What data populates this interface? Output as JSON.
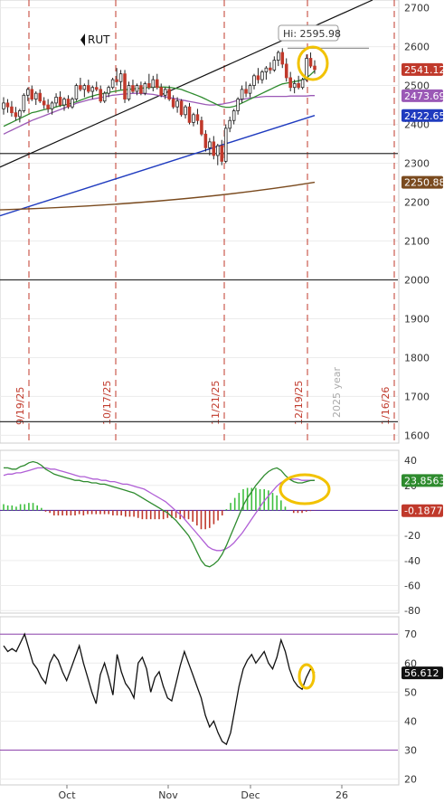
{
  "chart_data": [
    {
      "type": "candlestick",
      "ticker": "RUT",
      "y_ticks": [
        1600,
        1700,
        1800,
        1900,
        2000,
        2100,
        2200,
        2300,
        2400,
        2500,
        2600,
        2700
      ],
      "ylim": [
        1580,
        2720
      ],
      "x_labels": [
        "Oct",
        "Nov",
        "Dec",
        "26"
      ],
      "hi_label": "Hi: 2595.98",
      "hi_value": 2595.98,
      "badges": [
        {
          "text": "2541.12",
          "value": 2541.12,
          "color": "#c0392b"
        },
        {
          "text": "2473.69",
          "value": 2473.69,
          "color": "#9b59b6"
        },
        {
          "text": "2422.65",
          "value": 2422.65,
          "color": "#1f3bbf"
        },
        {
          "text": "2250.88",
          "value": 2250.88,
          "color": "#7a4a1e"
        }
      ],
      "horizontal_lines": [
        2325,
        2000,
        1635
      ],
      "vertical_date_labels": [
        "9/19/25",
        "10/17/25",
        "11/21/25",
        "12/19/25",
        "1/16/26"
      ],
      "year_label": "2025 year",
      "candles": [
        {
          "o": 2440,
          "h": 2470,
          "l": 2425,
          "c": 2455
        },
        {
          "o": 2455,
          "h": 2465,
          "l": 2430,
          "c": 2445
        },
        {
          "o": 2445,
          "h": 2460,
          "l": 2420,
          "c": 2430
        },
        {
          "o": 2430,
          "h": 2445,
          "l": 2410,
          "c": 2420
        },
        {
          "o": 2420,
          "h": 2440,
          "l": 2405,
          "c": 2435
        },
        {
          "o": 2435,
          "h": 2480,
          "l": 2430,
          "c": 2475
        },
        {
          "o": 2475,
          "h": 2495,
          "l": 2460,
          "c": 2490
        },
        {
          "o": 2490,
          "h": 2500,
          "l": 2460,
          "c": 2465
        },
        {
          "o": 2465,
          "h": 2485,
          "l": 2450,
          "c": 2480
        },
        {
          "o": 2480,
          "h": 2490,
          "l": 2455,
          "c": 2460
        },
        {
          "o": 2460,
          "h": 2470,
          "l": 2440,
          "c": 2450
        },
        {
          "o": 2450,
          "h": 2465,
          "l": 2430,
          "c": 2440
        },
        {
          "o": 2440,
          "h": 2460,
          "l": 2425,
          "c": 2455
        },
        {
          "o": 2455,
          "h": 2480,
          "l": 2445,
          "c": 2470
        },
        {
          "o": 2470,
          "h": 2485,
          "l": 2445,
          "c": 2450
        },
        {
          "o": 2450,
          "h": 2470,
          "l": 2435,
          "c": 2465
        },
        {
          "o": 2465,
          "h": 2475,
          "l": 2440,
          "c": 2445
        },
        {
          "o": 2445,
          "h": 2470,
          "l": 2440,
          "c": 2465
        },
        {
          "o": 2465,
          "h": 2505,
          "l": 2460,
          "c": 2500
        },
        {
          "o": 2500,
          "h": 2520,
          "l": 2485,
          "c": 2490
        },
        {
          "o": 2490,
          "h": 2505,
          "l": 2470,
          "c": 2500
        },
        {
          "o": 2500,
          "h": 2515,
          "l": 2480,
          "c": 2485
        },
        {
          "o": 2485,
          "h": 2500,
          "l": 2465,
          "c": 2495
        },
        {
          "o": 2495,
          "h": 2510,
          "l": 2485,
          "c": 2490
        },
        {
          "o": 2490,
          "h": 2500,
          "l": 2455,
          "c": 2460
        },
        {
          "o": 2460,
          "h": 2485,
          "l": 2455,
          "c": 2480
        },
        {
          "o": 2480,
          "h": 2500,
          "l": 2470,
          "c": 2495
        },
        {
          "o": 2495,
          "h": 2520,
          "l": 2490,
          "c": 2515
        },
        {
          "o": 2515,
          "h": 2545,
          "l": 2500,
          "c": 2510
        },
        {
          "o": 2510,
          "h": 2540,
          "l": 2490,
          "c": 2530
        },
        {
          "o": 2530,
          "h": 2540,
          "l": 2455,
          "c": 2465
        },
        {
          "o": 2465,
          "h": 2510,
          "l": 2460,
          "c": 2500
        },
        {
          "o": 2500,
          "h": 2515,
          "l": 2480,
          "c": 2485
        },
        {
          "o": 2485,
          "h": 2505,
          "l": 2475,
          "c": 2500
        },
        {
          "o": 2500,
          "h": 2510,
          "l": 2475,
          "c": 2480
        },
        {
          "o": 2480,
          "h": 2510,
          "l": 2475,
          "c": 2505
        },
        {
          "o": 2505,
          "h": 2530,
          "l": 2490,
          "c": 2495
        },
        {
          "o": 2495,
          "h": 2525,
          "l": 2485,
          "c": 2515
        },
        {
          "o": 2515,
          "h": 2530,
          "l": 2490,
          "c": 2495
        },
        {
          "o": 2495,
          "h": 2505,
          "l": 2470,
          "c": 2475
        },
        {
          "o": 2475,
          "h": 2495,
          "l": 2465,
          "c": 2490
        },
        {
          "o": 2490,
          "h": 2500,
          "l": 2460,
          "c": 2465
        },
        {
          "o": 2465,
          "h": 2475,
          "l": 2440,
          "c": 2445
        },
        {
          "o": 2445,
          "h": 2470,
          "l": 2430,
          "c": 2460
        },
        {
          "o": 2460,
          "h": 2465,
          "l": 2420,
          "c": 2425
        },
        {
          "o": 2425,
          "h": 2450,
          "l": 2415,
          "c": 2445
        },
        {
          "o": 2445,
          "h": 2455,
          "l": 2400,
          "c": 2405
        },
        {
          "o": 2405,
          "h": 2430,
          "l": 2395,
          "c": 2425
        },
        {
          "o": 2425,
          "h": 2440,
          "l": 2400,
          "c": 2410
        },
        {
          "o": 2410,
          "h": 2420,
          "l": 2370,
          "c": 2375
        },
        {
          "o": 2375,
          "h": 2385,
          "l": 2330,
          "c": 2340
        },
        {
          "o": 2340,
          "h": 2365,
          "l": 2320,
          "c": 2355
        },
        {
          "o": 2355,
          "h": 2370,
          "l": 2310,
          "c": 2320
        },
        {
          "o": 2320,
          "h": 2350,
          "l": 2295,
          "c": 2345
        },
        {
          "o": 2345,
          "h": 2360,
          "l": 2295,
          "c": 2305
        },
        {
          "o": 2305,
          "h": 2400,
          "l": 2300,
          "c": 2390
        },
        {
          "o": 2390,
          "h": 2420,
          "l": 2380,
          "c": 2410
        },
        {
          "o": 2410,
          "h": 2440,
          "l": 2400,
          "c": 2435
        },
        {
          "o": 2435,
          "h": 2470,
          "l": 2425,
          "c": 2465
        },
        {
          "o": 2465,
          "h": 2500,
          "l": 2455,
          "c": 2490
        },
        {
          "o": 2490,
          "h": 2510,
          "l": 2470,
          "c": 2480
        },
        {
          "o": 2480,
          "h": 2505,
          "l": 2470,
          "c": 2500
        },
        {
          "o": 2500,
          "h": 2530,
          "l": 2490,
          "c": 2525
        },
        {
          "o": 2525,
          "h": 2545,
          "l": 2505,
          "c": 2515
        },
        {
          "o": 2515,
          "h": 2540,
          "l": 2505,
          "c": 2535
        },
        {
          "o": 2535,
          "h": 2550,
          "l": 2515,
          "c": 2545
        },
        {
          "o": 2545,
          "h": 2560,
          "l": 2530,
          "c": 2540
        },
        {
          "o": 2540,
          "h": 2575,
          "l": 2535,
          "c": 2565
        },
        {
          "o": 2565,
          "h": 2590,
          "l": 2550,
          "c": 2585
        },
        {
          "o": 2585,
          "h": 2596,
          "l": 2545,
          "c": 2555
        },
        {
          "o": 2555,
          "h": 2570,
          "l": 2510,
          "c": 2520
        },
        {
          "o": 2520,
          "h": 2535,
          "l": 2485,
          "c": 2495
        },
        {
          "o": 2495,
          "h": 2515,
          "l": 2480,
          "c": 2505
        },
        {
          "o": 2505,
          "h": 2525,
          "l": 2490,
          "c": 2495
        },
        {
          "o": 2495,
          "h": 2520,
          "l": 2490,
          "c": 2515
        },
        {
          "o": 2515,
          "h": 2580,
          "l": 2510,
          "c": 2570
        },
        {
          "o": 2570,
          "h": 2585,
          "l": 2545,
          "c": 2550
        },
        {
          "o": 2550,
          "h": 2565,
          "l": 2530,
          "c": 2541
        }
      ],
      "sma_green": [
        2395,
        2400,
        2405,
        2410,
        2415,
        2420,
        2425,
        2430,
        2432,
        2435,
        2438,
        2440,
        2442,
        2445,
        2448,
        2450,
        2452,
        2455,
        2458,
        2462,
        2466,
        2470,
        2473,
        2476,
        2478,
        2480,
        2482,
        2484,
        2486,
        2488,
        2489,
        2490,
        2491,
        2492,
        2493,
        2494,
        2495,
        2496,
        2496,
        2496,
        2496,
        2495,
        2494,
        2492,
        2490,
        2486,
        2482,
        2478,
        2474,
        2470,
        2465,
        2460,
        2455,
        2450,
        2446,
        2444,
        2444,
        2446,
        2450,
        2455,
        2460,
        2465,
        2470,
        2475,
        2480,
        2485,
        2490,
        2495,
        2500,
        2504,
        2506,
        2508,
        2510,
        2512,
        2515,
        2520,
        2528,
        2538
      ],
      "sma_purple": [
        2375,
        2380,
        2385,
        2390,
        2395,
        2400,
        2405,
        2410,
        2414,
        2418,
        2422,
        2426,
        2430,
        2434,
        2438,
        2442,
        2446,
        2450,
        2454,
        2457,
        2460,
        2463,
        2465,
        2467,
        2469,
        2471,
        2473,
        2475,
        2476,
        2477,
        2478,
        2479,
        2480,
        2480,
        2480,
        2479,
        2478,
        2477,
        2475,
        2473,
        2471,
        2469,
        2467,
        2465,
        2463,
        2461,
        2459,
        2457,
        2455,
        2453,
        2451,
        2450,
        2450,
        2451,
        2452,
        2454,
        2456,
        2459,
        2462,
        2464,
        2466,
        2468,
        2469,
        2470,
        2471,
        2472,
        2472,
        2472,
        2472,
        2472,
        2472,
        2473,
        2473,
        2473,
        2473,
        2473,
        2474,
        2474
      ],
      "trend_black": {
        "from": 2290,
        "to": 2720
      },
      "trend_blue": {
        "from": 2165,
        "to": 2423
      },
      "sma_brown": {
        "from": 2180,
        "to": 2251
      }
    },
    {
      "type": "macd",
      "y_ticks": [
        40,
        20,
        0,
        -20,
        -40,
        -60,
        -80
      ],
      "ylim": [
        -82,
        48
      ],
      "badges": [
        {
          "text": "23.8563",
          "value": 23.8563,
          "color": "#2e8b2e"
        },
        {
          "text": "-0.1877",
          "value": -0.1877,
          "color": "#c0392b"
        }
      ],
      "macd_line": [
        34,
        34,
        33,
        33,
        35,
        36,
        38,
        39,
        38,
        36,
        33,
        31,
        29,
        28,
        27,
        26,
        25,
        24,
        24,
        23,
        23,
        22,
        22,
        21,
        21,
        20,
        19,
        18,
        17,
        16,
        15,
        14,
        12,
        10,
        8,
        6,
        4,
        2,
        0,
        -2,
        -5,
        -8,
        -12,
        -16,
        -20,
        -26,
        -33,
        -40,
        -44,
        -45,
        -43,
        -40,
        -35,
        -28,
        -20,
        -12,
        -4,
        4,
        10,
        15,
        20,
        24,
        28,
        31,
        33,
        34,
        32,
        28,
        25,
        23,
        22,
        22,
        23,
        23.9,
        24
      ],
      "signal_line": [
        28,
        29,
        29,
        30,
        30,
        31,
        32,
        33,
        34,
        34,
        34,
        33,
        33,
        32,
        31,
        30,
        29,
        28,
        27,
        27,
        26,
        25,
        25,
        24,
        24,
        23,
        23,
        22,
        21,
        21,
        20,
        19,
        18,
        17,
        15,
        13,
        11,
        9,
        7,
        4,
        1,
        -2,
        -5,
        -9,
        -13,
        -17,
        -21,
        -25,
        -29,
        -31,
        -32,
        -32,
        -31,
        -29,
        -26,
        -22,
        -18,
        -13,
        -8,
        -3,
        2,
        7,
        11,
        15,
        19,
        22,
        24,
        25,
        25,
        25,
        24,
        24,
        24,
        24
      ],
      "histogram": [
        5,
        4,
        4,
        3,
        5,
        5,
        6,
        6,
        4,
        2,
        -1,
        -2,
        -4,
        -4,
        -4,
        -4,
        -4,
        -4,
        -3,
        -4,
        -3,
        -3,
        -3,
        -3,
        -3,
        -3,
        -4,
        -4,
        -4,
        -5,
        -5,
        -5,
        -6,
        -7,
        -7,
        -7,
        -7,
        -7,
        -7,
        -6,
        -6,
        -6,
        -7,
        -7,
        -7,
        -9,
        -12,
        -15,
        -15,
        -14,
        -11,
        -8,
        -4,
        1,
        6,
        10,
        14,
        17,
        18,
        18,
        18,
        17,
        17,
        16,
        14,
        12,
        8,
        3,
        0,
        -2,
        -2,
        -2,
        -1,
        -0.5,
        -0.2
      ]
    },
    {
      "type": "line",
      "y_ticks": [
        20,
        30,
        40,
        50,
        60,
        70
      ],
      "ylim": [
        18,
        76
      ],
      "overbought": 70,
      "oversold": 30,
      "badge": {
        "text": "56.612",
        "value": 56.612,
        "color": "#111111"
      },
      "values": [
        66,
        64,
        65,
        64,
        67,
        70,
        65,
        60,
        58,
        55,
        53,
        60,
        63,
        61,
        57,
        54,
        58,
        62,
        66,
        60,
        55,
        50,
        46,
        56,
        60,
        55,
        49,
        63,
        57,
        53,
        51,
        48,
        60,
        62,
        58,
        50,
        55,
        57,
        52,
        48,
        47,
        53,
        59,
        64,
        60,
        56,
        52,
        48,
        42,
        38,
        40,
        36,
        33,
        32,
        36,
        44,
        52,
        58,
        61,
        63,
        60,
        62,
        64,
        60,
        58,
        62,
        68,
        64,
        58,
        54,
        52,
        51,
        55,
        58,
        56.6
      ]
    }
  ],
  "annotations": {
    "circle_color": "#f2c200"
  }
}
